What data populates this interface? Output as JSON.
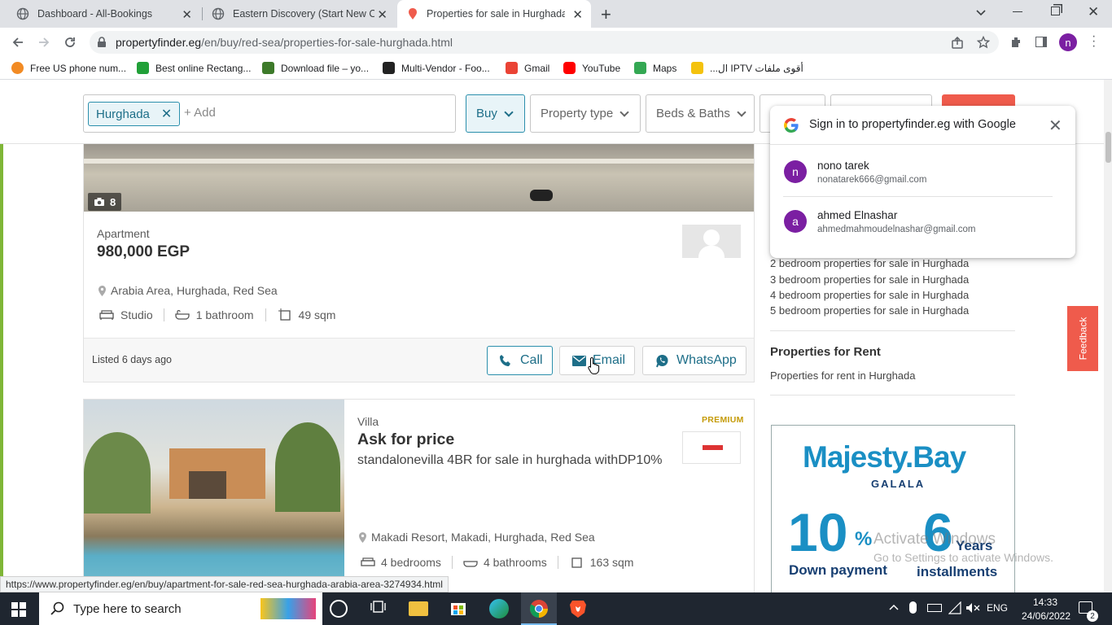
{
  "tabs": [
    {
      "title": "Dashboard - All-Bookings"
    },
    {
      "title": "Eastern Discovery (Start New Orde"
    },
    {
      "title": "Properties for sale in Hurghada -"
    }
  ],
  "address": {
    "host": "propertyfinder.eg",
    "path": "/en/buy/red-sea/properties-for-sale-hurghada.html"
  },
  "bookmarks": [
    {
      "label": "Free US phone num...",
      "color": "#f28b24"
    },
    {
      "label": "Best online Rectang...",
      "color": "#21a038"
    },
    {
      "label": "Download file – yo...",
      "color": "#3d7a2a"
    },
    {
      "label": "Multi-Vendor - Foo...",
      "color": "#222222"
    },
    {
      "label": "Gmail",
      "color": "#ea4335"
    },
    {
      "label": "YouTube",
      "color": "#ff0000"
    },
    {
      "label": "Maps",
      "color": "#34a853"
    },
    {
      "label": "أقوى ملفات IPTV ال...",
      "color": "#f4c20d"
    }
  ],
  "search": {
    "location": "Hurghada",
    "add": "+ Add",
    "buy": "Buy",
    "property_type": "Property type",
    "beds_baths": "Beds & Baths"
  },
  "listing1": {
    "photo_count": "8",
    "type": "Apartment",
    "price": "980,000 EGP",
    "location": "Arabia Area, Hurghada, Red Sea",
    "beds": "Studio",
    "baths": "1 bathroom",
    "area": "49 sqm",
    "listed": "Listed 6 days ago",
    "call": "Call",
    "email": "Email",
    "whatsapp": "WhatsApp"
  },
  "listing2": {
    "type": "Villa",
    "badge": "PREMIUM",
    "price": "Ask for price",
    "title": "standalonevilla 4BR for sale in hurghada withDP10%",
    "location": "Makadi Resort, Makadi, Hurghada, Red Sea",
    "beds": "4 bedrooms",
    "baths": "4 bathrooms",
    "area": "163 sqm"
  },
  "sidebar": {
    "links": [
      "2 bedroom properties for sale in Hurghada",
      "3 bedroom properties for sale in Hurghada",
      "4 bedroom properties for sale in Hurghada",
      "5 bedroom properties for sale in Hurghada"
    ],
    "rent_heading": "Properties for Rent",
    "rent_link": "Properties for rent in Hurghada"
  },
  "ad": {
    "brand": "Majesty.Bay",
    "sub": "GALALA",
    "pct_num": "10",
    "pct_sym": "%",
    "pct_label": "Down payment",
    "years_num": "6",
    "years_word": "Years",
    "years_label": "installments"
  },
  "feedback": "Feedback",
  "google_popup": {
    "title": "Sign in to propertyfinder.eg with Google",
    "accounts": [
      {
        "initial": "n",
        "name": "nono tarek",
        "email": "nonatarek666@gmail.com"
      },
      {
        "initial": "a",
        "name": "ahmed Elnashar",
        "email": "ahmedmahmoudelnashar@gmail.com"
      }
    ]
  },
  "status_url": "https://www.propertyfinder.eg/en/buy/apartment-for-sale-red-sea-hurghada-arabia-area-3274934.html",
  "watermark": {
    "line1": "Activate Windows",
    "line2": "Go to Settings to activate Windows."
  },
  "taskbar": {
    "search_placeholder": "Type here to search",
    "lang": "ENG",
    "time": "14:33",
    "date": "24/06/2022",
    "notifications": "2"
  },
  "profile_initial": "n"
}
